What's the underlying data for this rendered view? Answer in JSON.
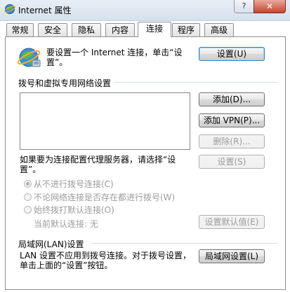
{
  "window": {
    "title": "Internet 属性",
    "help_label": "?",
    "close_label": "✕"
  },
  "tabs": [
    {
      "label": "常规"
    },
    {
      "label": "安全"
    },
    {
      "label": "隐私"
    },
    {
      "label": "内容"
    },
    {
      "label": "连接",
      "active": true
    },
    {
      "label": "程序"
    },
    {
      "label": "高级"
    }
  ],
  "setup": {
    "text": "要设置一个 Internet 连接，单击“设置”。",
    "button_label": "设置(U)"
  },
  "dialup": {
    "group_title": "拨号和虚拟专用网络设置",
    "add_label": "添加(D)...",
    "add_vpn_label": "添加 VPN(P)...",
    "remove_label": "删除(R)...",
    "proxy_text": "如果要为连接配置代理服务器，请选择“设置”。",
    "settings_label": "设置(S)",
    "radio_never": "从不进行拨号连接(C)",
    "radio_when_no_network": "不论网络连接是否存在都进行拨号(W)",
    "radio_always": "始终拨打默认连接(O)",
    "current_default_label": "当前默认连接:",
    "current_default_value": "无",
    "set_default_label": "设置默认值(E)"
  },
  "lan": {
    "group_title": "局域网(LAN)设置",
    "text": "LAN 设置不应用到拨号连接。对于拨号设置，单击上面的“设置”按钮。",
    "button_label": "局域网设置(L)"
  }
}
